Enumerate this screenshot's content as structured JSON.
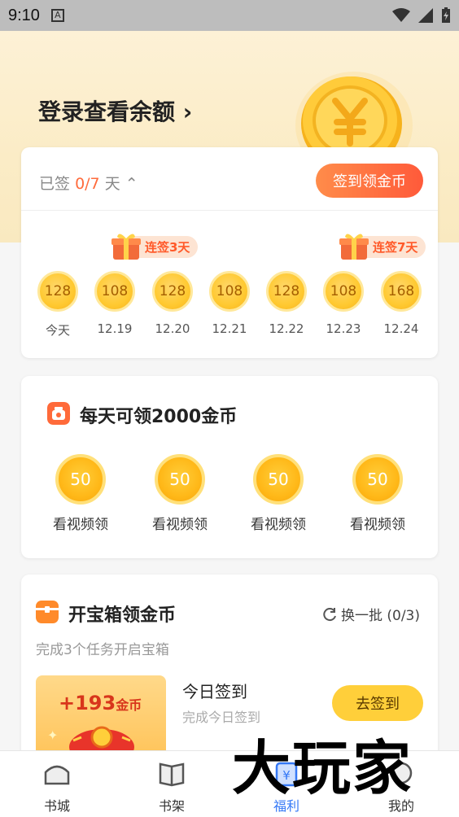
{
  "status_bar": {
    "time": "9:10"
  },
  "hero": {
    "title": "登录查看余额",
    "chevron": "›"
  },
  "signin": {
    "status_prefix": "已签",
    "status_count": "0/7",
    "status_suffix": "天",
    "button_label": "签到领金币",
    "gifts": [
      {
        "label": "连签3天"
      },
      {
        "label": "连签7天"
      }
    ],
    "days": [
      {
        "value": "128",
        "label": "今天"
      },
      {
        "value": "108",
        "label": "12.19"
      },
      {
        "value": "128",
        "label": "12.20"
      },
      {
        "value": "108",
        "label": "12.21"
      },
      {
        "value": "128",
        "label": "12.22"
      },
      {
        "value": "108",
        "label": "12.23"
      },
      {
        "value": "168",
        "label": "12.24"
      }
    ]
  },
  "video": {
    "title": "每天可领2000金币",
    "items": [
      {
        "value": "50",
        "label": "看视频领"
      },
      {
        "value": "50",
        "label": "看视频领"
      },
      {
        "value": "50",
        "label": "看视频领"
      },
      {
        "value": "50",
        "label": "看视频领"
      }
    ]
  },
  "treasure": {
    "title": "开宝箱领金币",
    "refresh_label": "换一批 (0/3)",
    "subtitle": "完成3个任务开启宝箱",
    "reward_amount": "+193",
    "reward_unit": "金币",
    "task_title": "今日签到",
    "task_subtitle": "完成今日签到",
    "task_button": "去签到"
  },
  "tabs": [
    {
      "label": "书城",
      "icon": "bookstore-icon"
    },
    {
      "label": "书架",
      "icon": "bookshelf-icon"
    },
    {
      "label": "福利",
      "icon": "welfare-icon"
    },
    {
      "label": "我的",
      "icon": "profile-icon"
    }
  ],
  "watermark": "大玩家",
  "colors": {
    "accent": "#ff5a3a",
    "tab_active": "#3478f6",
    "coin": "#ffc930"
  }
}
